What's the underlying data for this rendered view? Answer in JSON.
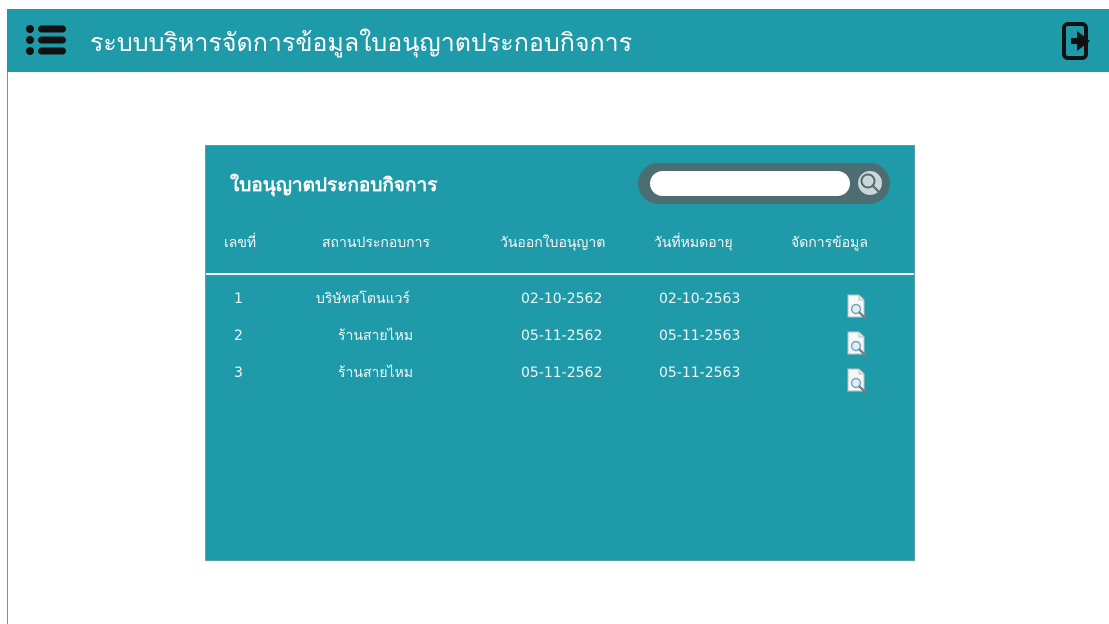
{
  "app": {
    "title": "ระบบบริหารจัดการข้อมูลใบอนุญาตประกอบกิจการ"
  },
  "header": {
    "menu_icon": "menu-icon",
    "exit_icon": "exit-icon"
  },
  "panel": {
    "title": "ใบอนุญาตประกอบกิจการ",
    "search": {
      "placeholder": "",
      "value": ""
    }
  },
  "table": {
    "columns": [
      "เลขที่",
      "สถานประกอบการ",
      "วันออกใบอนุญาต",
      "วันที่หมดอายุ",
      "จัดการข้อมูล"
    ],
    "rows": [
      {
        "no": "1",
        "business": "บริษัทสโตนแวร์",
        "issued": "02-10-2562",
        "expires": "02-10-2563"
      },
      {
        "no": "2",
        "business": "ร้านสายไหม",
        "issued": "05-11-2562",
        "expires": "05-11-2563"
      },
      {
        "no": "3",
        "business": "ร้านสายไหม",
        "issued": "05-11-2562",
        "expires": "05-11-2563"
      }
    ]
  },
  "colors": {
    "primary": "#1f9aa8",
    "search_bg": "#4c6e73",
    "text_light": "#ffffff"
  }
}
